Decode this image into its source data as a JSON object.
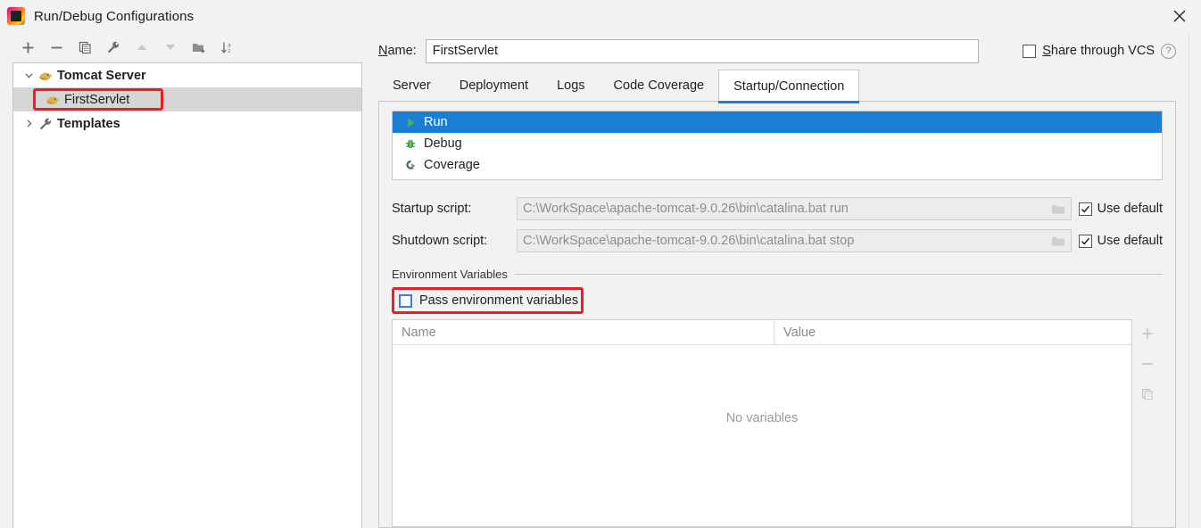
{
  "window": {
    "title": "Run/Debug Configurations",
    "app_icon": "intellij-idea-icon",
    "close_icon": "close-icon"
  },
  "left_panel": {
    "toolbar": [
      {
        "name": "add-configuration-button",
        "icon": "plus-icon",
        "enabled": true
      },
      {
        "name": "remove-configuration-button",
        "icon": "minus-icon",
        "enabled": true
      },
      {
        "name": "copy-configuration-button",
        "icon": "copy-icon",
        "enabled": true
      },
      {
        "name": "edit-templates-button",
        "icon": "wrench-icon",
        "enabled": true
      },
      {
        "name": "move-up-button",
        "icon": "arrow-up-icon",
        "enabled": false
      },
      {
        "name": "move-down-button",
        "icon": "arrow-down-icon",
        "enabled": false
      },
      {
        "name": "new-folder-button",
        "icon": "folder-add-icon",
        "enabled": true
      },
      {
        "name": "sort-configurations-button",
        "icon": "sort-alpha-icon",
        "enabled": true
      }
    ],
    "tree": [
      {
        "label": "Tomcat Server",
        "icon": "tomcat-icon",
        "bold": true,
        "expanded": true,
        "level": 0,
        "selected": false
      },
      {
        "label": "FirstServlet",
        "icon": "tomcat-icon",
        "bold": false,
        "level": 1,
        "selected": true,
        "highlighted": true
      },
      {
        "label": "Templates",
        "icon": "wrench-icon",
        "bold": true,
        "expanded": false,
        "level": 0,
        "selected": false
      }
    ]
  },
  "right_panel": {
    "name_label": "Name:",
    "name_value": "FirstServlet",
    "name_placeholder": "",
    "share_vcs_label": "Share through VCS",
    "share_vcs_checked": false,
    "help_glyph": "?",
    "tabs": [
      {
        "label": "Server",
        "active": false
      },
      {
        "label": "Deployment",
        "active": false
      },
      {
        "label": "Logs",
        "active": false
      },
      {
        "label": "Code Coverage",
        "active": false
      },
      {
        "label": "Startup/Connection",
        "active": true,
        "highlighted": true
      }
    ],
    "modes": [
      {
        "label": "Run",
        "icon": "run-play-icon",
        "selected": true
      },
      {
        "label": "Debug",
        "icon": "debug-bug-icon",
        "selected": false
      },
      {
        "label": "Coverage",
        "icon": "coverage-icon",
        "selected": false
      }
    ],
    "startup_script": {
      "label": "Startup script:",
      "value": "C:\\WorkSpace\\apache-tomcat-9.0.26\\bin\\catalina.bat run",
      "browse_icon": "folder-icon",
      "use_default_label": "Use default",
      "use_default_checked": true
    },
    "shutdown_script": {
      "label": "Shutdown script:",
      "value": "C:\\WorkSpace\\apache-tomcat-9.0.26\\bin\\catalina.bat stop",
      "browse_icon": "folder-icon",
      "use_default_label": "Use default",
      "use_default_checked": true
    },
    "environment": {
      "section_title": "Environment Variables",
      "pass_env_label": "Pass environment variables",
      "pass_env_checked": false,
      "pass_env_highlighted": true,
      "columns": [
        "Name",
        "Value"
      ],
      "empty_text": "No variables",
      "rows": [],
      "side_tools": [
        {
          "name": "add-variable-button",
          "icon": "plus-icon"
        },
        {
          "name": "remove-variable-button",
          "icon": "minus-icon"
        },
        {
          "name": "copy-variable-button",
          "icon": "copy-icon"
        }
      ]
    }
  },
  "colors": {
    "selection_blue": "#1a7fd4",
    "annotation_red": "#ee1c24",
    "tree_selection_gray": "#d6d6d6",
    "window_bg": "#f2f2f2",
    "checkbox_blue": "#3a7fd5"
  }
}
